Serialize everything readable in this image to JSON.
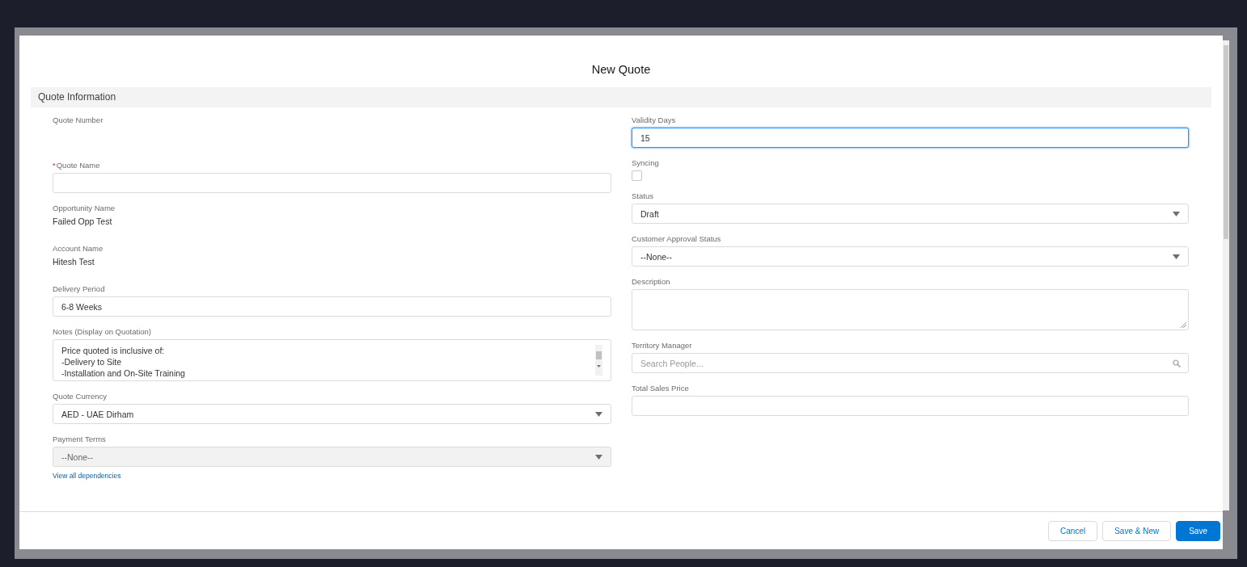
{
  "dialog": {
    "title": "New Quote"
  },
  "section": {
    "title": "Quote Information"
  },
  "columns": [
    {
      "fields": [
        {
          "kind": "static",
          "label": "Quote Number"
        },
        {
          "kind": "input",
          "label": "Quote Name",
          "required_mark": "*",
          "focused": false
        },
        {
          "kind": "static",
          "label": "Opportunity Name",
          "value": "Failed Opp Test"
        },
        {
          "kind": "static",
          "label": "Account Name",
          "value": "Hitesh Test"
        },
        {
          "kind": "input",
          "label": "Delivery Period",
          "focused": false,
          "value": "6-8 Weeks"
        },
        {
          "kind": "textarea",
          "label": "Notes (Display on Quotation)",
          "lines": [
            "Price quoted is inclusive of:",
            "-Delivery to Site",
            "-Installation and On-Site Training"
          ]
        },
        {
          "kind": "select",
          "label": "Quote Currency",
          "disabled": false,
          "value": "AED - UAE Dirham"
        },
        {
          "kind": "select",
          "label": "Payment Terms",
          "disabled": true,
          "value": "--None--",
          "link": "View all dependencies"
        }
      ]
    },
    {
      "fields": [
        {
          "kind": "input",
          "label": "Validity Days",
          "focused": true,
          "value": "15"
        },
        {
          "kind": "checkbox",
          "label": "Syncing",
          "checked": false
        },
        {
          "kind": "select",
          "label": "Status",
          "disabled": false,
          "value": "Draft"
        },
        {
          "kind": "select",
          "label": "Customer Approval Status",
          "disabled": false,
          "value": "--None--"
        },
        {
          "kind": "textarea",
          "label": "Description"
        },
        {
          "kind": "lookup",
          "label": "Territory Manager",
          "placeholder": "Search People..."
        },
        {
          "kind": "input",
          "label": "Total Sales Price",
          "focused": false
        }
      ]
    }
  ],
  "buttons": [
    {
      "label": "Cancel",
      "kind": "neutral"
    },
    {
      "label": "Save & New",
      "kind": "neutral"
    },
    {
      "label": "Save",
      "kind": "brand"
    }
  ]
}
